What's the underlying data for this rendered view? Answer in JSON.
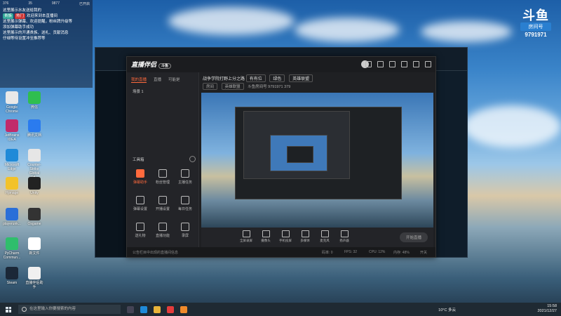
{
  "chat": {
    "stats": [
      "376",
      "35",
      "9877"
    ],
    "stat_label": "已开启",
    "messages": [
      "这里展示水友送给我的",
      "欢迎来到本直播间",
      "这里展示弹幕、欢迎提醒，粉丝牌升级等",
      "添加弹幕助手成功",
      "这里展示的开通贵族、送礼、贡献消息",
      "仔细等待设置冲至推荐等"
    ],
    "tags": [
      "贵族",
      "热门"
    ]
  },
  "douyu": {
    "logo": "斗鱼",
    "room_label": "房间号",
    "room_number": "9791971"
  },
  "desktop_icons": [
    {
      "label": "Google Chrome",
      "color": "#e8e8e8"
    },
    {
      "label": "微信",
      "color": "#2fbe4f"
    },
    {
      "label": "JetBrains IDEA",
      "color": "#c12b6b"
    },
    {
      "label": "腾讯文档",
      "color": "#2a7bef"
    },
    {
      "label": "Microsoft Edge",
      "color": "#1f8ad8"
    },
    {
      "label": "Counter-Strike Global Off...",
      "color": "#e6e6e6"
    },
    {
      "label": "Hjimage",
      "color": "#f2c22a"
    },
    {
      "label": "Unity",
      "color": "#222222"
    },
    {
      "label": "playerunk...",
      "color": "#2a6fd8"
    },
    {
      "label": "Osgame",
      "color": "#333333"
    },
    {
      "label": "PyCharm Commun...",
      "color": "#2fbe6c"
    },
    {
      "label": "新文件",
      "color": "#ffffff"
    },
    {
      "label": "Steam",
      "color": "#1b2838"
    },
    {
      "label": "直播伴侣助手",
      "color": "#f0f0f0"
    }
  ],
  "app": {
    "title": "直播伴侣",
    "badge": "斗鱼",
    "tabs": [
      "我的直播",
      "直播",
      "可能是"
    ],
    "scene": "场景 1",
    "stream_title": "战争学院打野上分之路",
    "category_label": "有有位",
    "category_value": "绿色",
    "game": "英雄联盟",
    "room_label": "房间",
    "room_type": "英雄联盟",
    "room_id_label": "斗鱼房间号",
    "room_id": "9791971",
    "heat": "379",
    "tools_title": "工具箱",
    "tools": [
      {
        "label": "弹幕助手",
        "hot": true
      },
      {
        "label": "粉丝管理",
        "hot": false
      },
      {
        "label": "主播任务",
        "hot": false
      },
      {
        "label": "弹幕设置",
        "hot": false
      },
      {
        "label": "开播设置",
        "hot": false
      },
      {
        "label": "每日任务",
        "hot": false
      },
      {
        "label": "送礼物",
        "hot": false
      },
      {
        "label": "直播功能",
        "hot": false
      },
      {
        "label": "录屏",
        "hot": false
      }
    ],
    "controls": [
      "全屏录屏",
      "摄像头",
      "手机投屏",
      "多媒体",
      "麦克风",
      "扬声器"
    ],
    "start_label": "开始直播",
    "hint": "公告栏目中出现的直播间信息",
    "status": [
      "码率: 0",
      "FPS: 32",
      "CPU: 12%",
      "内存: 48%",
      "开关"
    ]
  },
  "taskbar": {
    "search_placeholder": "在这里输入你要搜索的内容",
    "weather": "10°C 多云",
    "time": "15:58",
    "date": "2021/12/27"
  }
}
